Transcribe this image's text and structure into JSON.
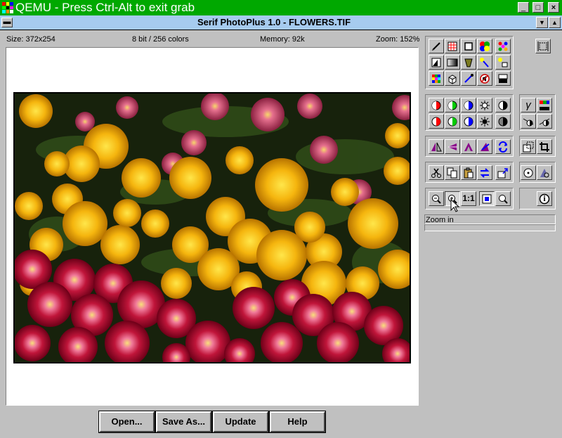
{
  "qemu": {
    "title": "QEMU - Press Ctrl-Alt to exit grab",
    "minimize": "_",
    "maximize": "□",
    "close": "×"
  },
  "app": {
    "title": "Serif PhotoPlus 1.0 - FLOWERS.TIF",
    "scroll_up": "▲",
    "scroll_down": "▼"
  },
  "info": {
    "size": "Size: 372x254",
    "depth": "8 bit / 256 colors",
    "memory": "Memory: 92k",
    "zoom": "Zoom: 152%"
  },
  "buttons": {
    "open": "Open...",
    "save_as": "Save As...",
    "update": "Update",
    "help": "Help"
  },
  "status": {
    "label": "Zoom in"
  },
  "toolbar": {
    "ratio_label": "1:1",
    "gamma_label": "γ",
    "info_label": "i"
  },
  "colors": {
    "qemu_green": "#00a800",
    "caption_blue": "#a6cbef",
    "face": "#c0c0c0"
  }
}
